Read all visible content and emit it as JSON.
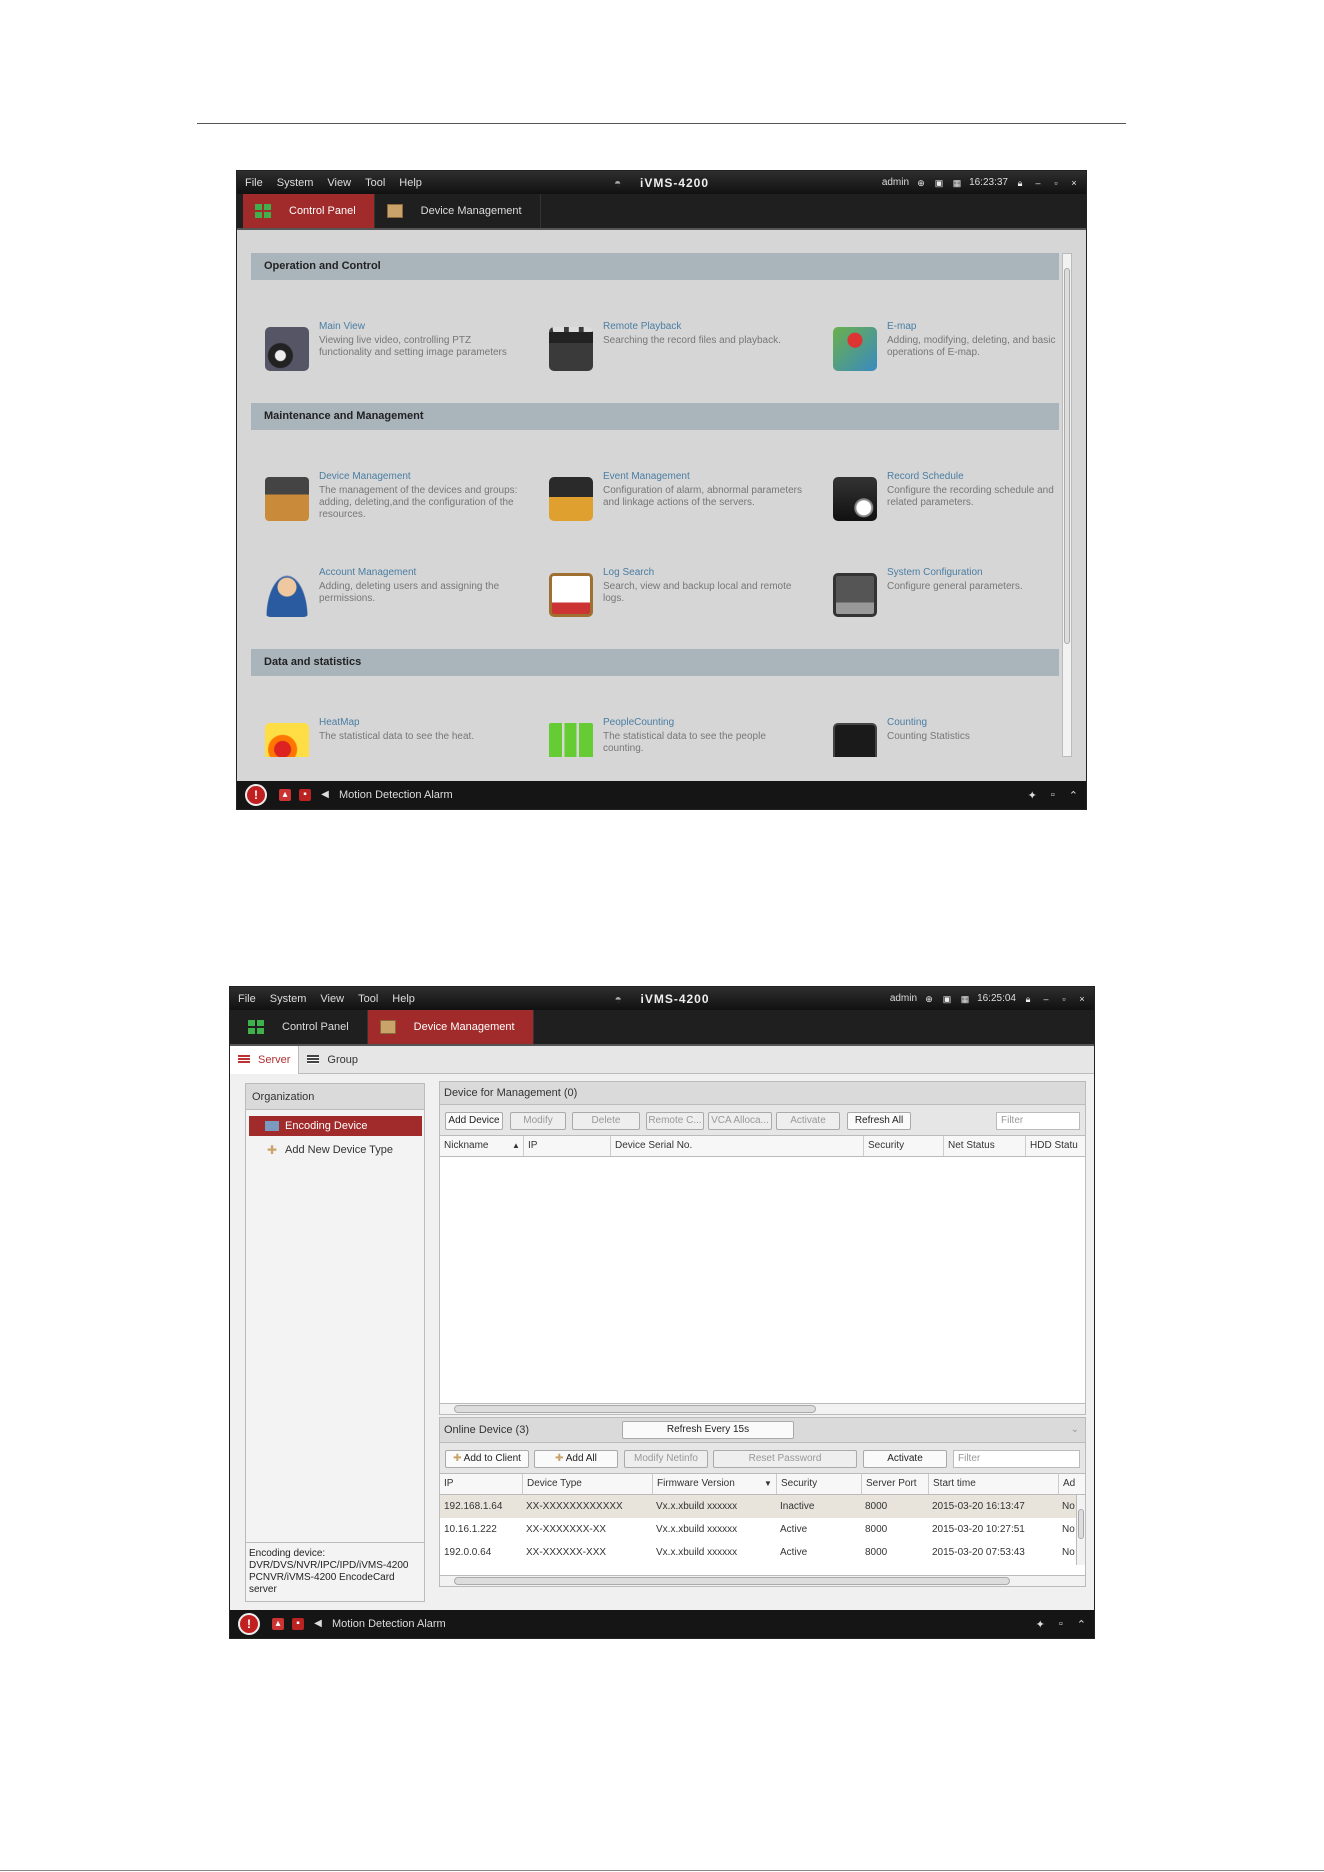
{
  "colors": {
    "accent": "#a12a2a",
    "titlebar": "#1a1a1a",
    "section": "#a9b4bb",
    "link": "#4a7ea3"
  },
  "menu": [
    "File",
    "System",
    "View",
    "Tool",
    "Help"
  ],
  "app_title": "iVMS-4200",
  "tabs": {
    "control_panel": "Control Panel",
    "device_management": "Device Management"
  },
  "window1": {
    "user": "admin",
    "time": "16:23:37",
    "sections": [
      {
        "title": "Operation and Control",
        "modules": [
          {
            "name": "Main View",
            "desc": "Viewing live video, controlling PTZ functionality and setting image parameters",
            "icon": "monitor-camera-icon"
          },
          {
            "name": "Remote Playback",
            "desc": "Searching the record files and playback.",
            "icon": "playback-clapper-icon"
          },
          {
            "name": "E-map",
            "desc": "Adding, modifying, deleting, and basic operations of E-map.",
            "icon": "map-pin-icon"
          }
        ]
      },
      {
        "title": "Maintenance and Management",
        "modules": [
          {
            "name": "Device Management",
            "desc": "The management of the devices and groups: adding, deleting,and the configuration of the resources.",
            "icon": "device-management-icon"
          },
          {
            "name": "Event Management",
            "desc": "Configuration of alarm, abnormal parameters and linkage actions of the servers.",
            "icon": "event-management-icon"
          },
          {
            "name": "Record Schedule",
            "desc": "Configure the recording schedule and related parameters.",
            "icon": "record-schedule-icon"
          },
          {
            "name": "Account Management",
            "desc": "Adding, deleting users and assigning the permissions.",
            "icon": "account-user-icon"
          },
          {
            "name": "Log Search",
            "desc": "Search, view and backup local and remote logs.",
            "icon": "log-search-icon"
          },
          {
            "name": "System Configuration",
            "desc": "Configure general parameters.",
            "icon": "system-configuration-icon"
          }
        ]
      },
      {
        "title": "Data and statistics",
        "modules": [
          {
            "name": "HeatMap",
            "desc": "The statistical data to see the heat.",
            "icon": "heatmap-icon"
          },
          {
            "name": "PeopleCounting",
            "desc": "The statistical data to see the people counting.",
            "icon": "people-counting-icon"
          },
          {
            "name": "Counting",
            "desc": "Counting Statistics",
            "icon": "counting-icon"
          }
        ]
      }
    ],
    "status": "Motion Detection Alarm"
  },
  "window2": {
    "user": "admin",
    "time": "16:25:04",
    "subtabs": [
      "Server",
      "Group"
    ],
    "organization": "Organization",
    "tree": [
      "Encoding Device",
      "Add New Device Type"
    ],
    "note": "Encoding device: DVR/DVS/NVR/IPC/IPD/iVMS-4200 PCNVR/iVMS-4200 EncodeCard server",
    "device_header": "Device for Management (0)",
    "device_buttons": [
      "Add Device",
      "Modify",
      "Delete",
      "Remote C...",
      "VCA Alloca...",
      "Activate",
      "Refresh All"
    ],
    "filter": "Filter",
    "device_columns": [
      "Nickname",
      "IP",
      "Device Serial No.",
      "Security",
      "Net Status",
      "HDD Statu"
    ],
    "online_header": "Online Device (3)",
    "refresh_label": "Refresh Every 15s",
    "online_buttons": [
      "Add to Client",
      "Add All",
      "Modify Netinfo",
      "Reset Password",
      "Activate"
    ],
    "online_columns": [
      "IP",
      "Device Type",
      "Firmware Version",
      "Security",
      "Server Port",
      "Start time",
      "Ad"
    ],
    "online_rows": [
      [
        "192.168.1.64",
        "XX-XXXXXXXXXXXX",
        "Vx.x.xbuild xxxxxx",
        "Inactive",
        "8000",
        "2015-03-20 16:13:47",
        "No"
      ],
      [
        "10.16.1.222",
        "XX-XXXXXXX-XX",
        "Vx.x.xbuild xxxxxx",
        "Active",
        "8000",
        "2015-03-20 10:27:51",
        "No"
      ],
      [
        "192.0.0.64",
        "XX-XXXXXX-XXX",
        "Vx.x.xbuild xxxxxx",
        "Active",
        "8000",
        "2015-03-20 07:53:43",
        "No"
      ]
    ],
    "status": "Motion Detection Alarm"
  }
}
